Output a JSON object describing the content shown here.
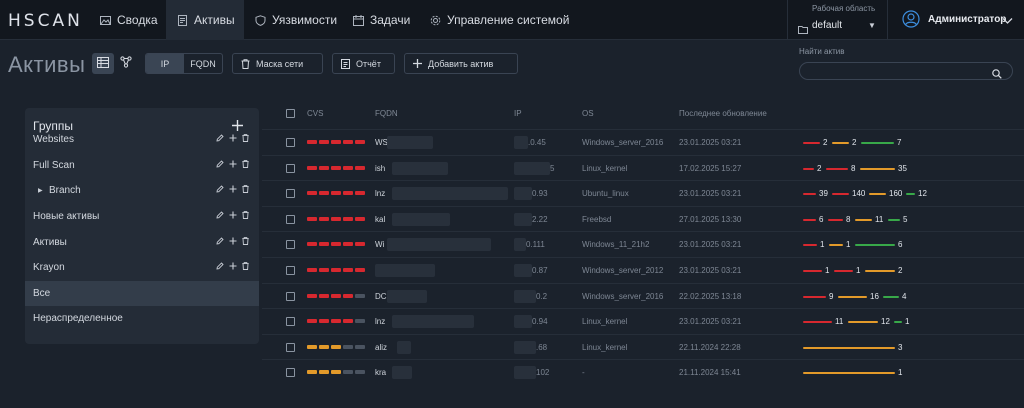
{
  "app": {
    "logo_text": "HSCAN"
  },
  "nav": [
    {
      "label": "Сводка",
      "icon": "image-icon"
    },
    {
      "label": "Активы",
      "icon": "document-icon",
      "active": true
    },
    {
      "label": "Уязвимости",
      "icon": "shield-icon"
    },
    {
      "label": "Задачи",
      "icon": "calendar-icon"
    },
    {
      "label": "Управление системой",
      "icon": "gear-icon"
    }
  ],
  "workspace": {
    "label": "Рабочая область",
    "value": "default"
  },
  "user": {
    "name": "Администратор"
  },
  "page": {
    "title": "Активы"
  },
  "toolbar": {
    "ip_label": "IP",
    "fqdn_label": "FQDN",
    "netmask_label": "Маска сети",
    "report_label": "Отчёт",
    "add_asset_label": "Добавить актив"
  },
  "search": {
    "label": "Найти актив",
    "placeholder": ""
  },
  "groups": {
    "title": "Группы",
    "items": [
      {
        "label": "Websites",
        "actions": true
      },
      {
        "label": "Full Scan",
        "actions": true
      },
      {
        "label": "Branch",
        "actions": true,
        "child": true
      },
      {
        "label": "Новые активы",
        "actions": true
      },
      {
        "label": "Активы",
        "actions": true
      },
      {
        "label": "Krayon",
        "actions": true
      },
      {
        "label": "Все",
        "actions": false,
        "selected": true
      },
      {
        "label": "Нераспределенное",
        "actions": false
      }
    ]
  },
  "table": {
    "columns": {
      "cvss": "CVS",
      "fqdn": "FQDN",
      "ip": "IP",
      "os": "OS",
      "updated": "Последнее обновление"
    },
    "rows": [
      {
        "fqdn": "WS",
        "ip": ".0.45",
        "os": "Windows_server_2016",
        "updated": "23.01.2025 03:21",
        "cvss_level": 5,
        "cvss_color": "#d7282f",
        "stats": [
          {
            "v": "2",
            "c": "#d7282f"
          },
          {
            "v": "2",
            "c": "#e39a2a"
          },
          {
            "v": "7",
            "c": "#38a849"
          }
        ]
      },
      {
        "fqdn": "ish",
        "ip": "5",
        "os": "Linux_kernel",
        "updated": "17.02.2025 15:27",
        "cvss_level": 5,
        "cvss_color": "#d7282f",
        "stats": [
          {
            "v": "2",
            "c": "#d7282f"
          },
          {
            "v": "8",
            "c": "#d7282f"
          },
          {
            "v": "35",
            "c": "#e39a2a"
          }
        ]
      },
      {
        "fqdn": "lnz",
        "ip": "0.93",
        "os": "Ubuntu_linux",
        "updated": "23.01.2025 03:21",
        "cvss_level": 5,
        "cvss_color": "#d7282f",
        "stats": [
          {
            "v": "39",
            "c": "#d7282f"
          },
          {
            "v": "140",
            "c": "#d7282f"
          },
          {
            "v": "160",
            "c": "#e39a2a"
          },
          {
            "v": "12",
            "c": "#38a849"
          }
        ]
      },
      {
        "fqdn": "kal",
        "ip": "2.22",
        "os": "Freebsd",
        "updated": "27.01.2025 13:30",
        "cvss_level": 5,
        "cvss_color": "#d7282f",
        "stats": [
          {
            "v": "6",
            "c": "#d7282f"
          },
          {
            "v": "8",
            "c": "#d7282f"
          },
          {
            "v": "11",
            "c": "#e39a2a"
          },
          {
            "v": "5",
            "c": "#38a849"
          }
        ]
      },
      {
        "fqdn": "Wi",
        "ip": "0.111",
        "os": "Windows_11_21h2",
        "updated": "23.01.2025 03:21",
        "cvss_level": 5,
        "cvss_color": "#d7282f",
        "stats": [
          {
            "v": "1",
            "c": "#d7282f"
          },
          {
            "v": "1",
            "c": "#e39a2a"
          },
          {
            "v": "6",
            "c": "#38a849"
          }
        ]
      },
      {
        "fqdn": "",
        "ip": "0.87",
        "os": "Windows_server_2012",
        "updated": "23.01.2025 03:21",
        "cvss_level": 5,
        "cvss_color": "#d7282f",
        "stats": [
          {
            "v": "1",
            "c": "#d7282f"
          },
          {
            "v": "1",
            "c": "#d7282f"
          },
          {
            "v": "2",
            "c": "#e39a2a"
          }
        ]
      },
      {
        "fqdn": "DC",
        "ip": "0.2",
        "os": "Windows_server_2016",
        "updated": "22.02.2025 13:18",
        "cvss_level": 4,
        "cvss_color": "#d7282f",
        "stats": [
          {
            "v": "9",
            "c": "#d7282f"
          },
          {
            "v": "16",
            "c": "#e39a2a"
          },
          {
            "v": "4",
            "c": "#38a849"
          }
        ]
      },
      {
        "fqdn": "lnz",
        "ip": "0.94",
        "os": "Linux_kernel",
        "updated": "23.01.2025 03:21",
        "cvss_level": 4,
        "cvss_color": "#d7282f",
        "stats": [
          {
            "v": "11",
            "c": "#d7282f"
          },
          {
            "v": "12",
            "c": "#e39a2a"
          },
          {
            "v": "1",
            "c": "#38a849"
          }
        ]
      },
      {
        "fqdn": "aliz",
        "ip": ".68",
        "os": "Linux_kernel",
        "updated": "22.11.2024 22:28",
        "cvss_level": 3,
        "cvss_color": "#e39a2a",
        "stats": [
          {
            "v": "3",
            "c": "#e39a2a"
          }
        ]
      },
      {
        "fqdn": "kra",
        "ip": "102",
        "os": "-",
        "updated": "21.11.2024 15:41",
        "cvss_level": 3,
        "cvss_color": "#e39a2a",
        "stats": [
          {
            "v": "1",
            "c": "#e39a2a"
          }
        ]
      }
    ]
  },
  "colors": {
    "critical": "#d7282f",
    "medium": "#e39a2a",
    "low": "#38a849",
    "empty": "#4a5360"
  }
}
